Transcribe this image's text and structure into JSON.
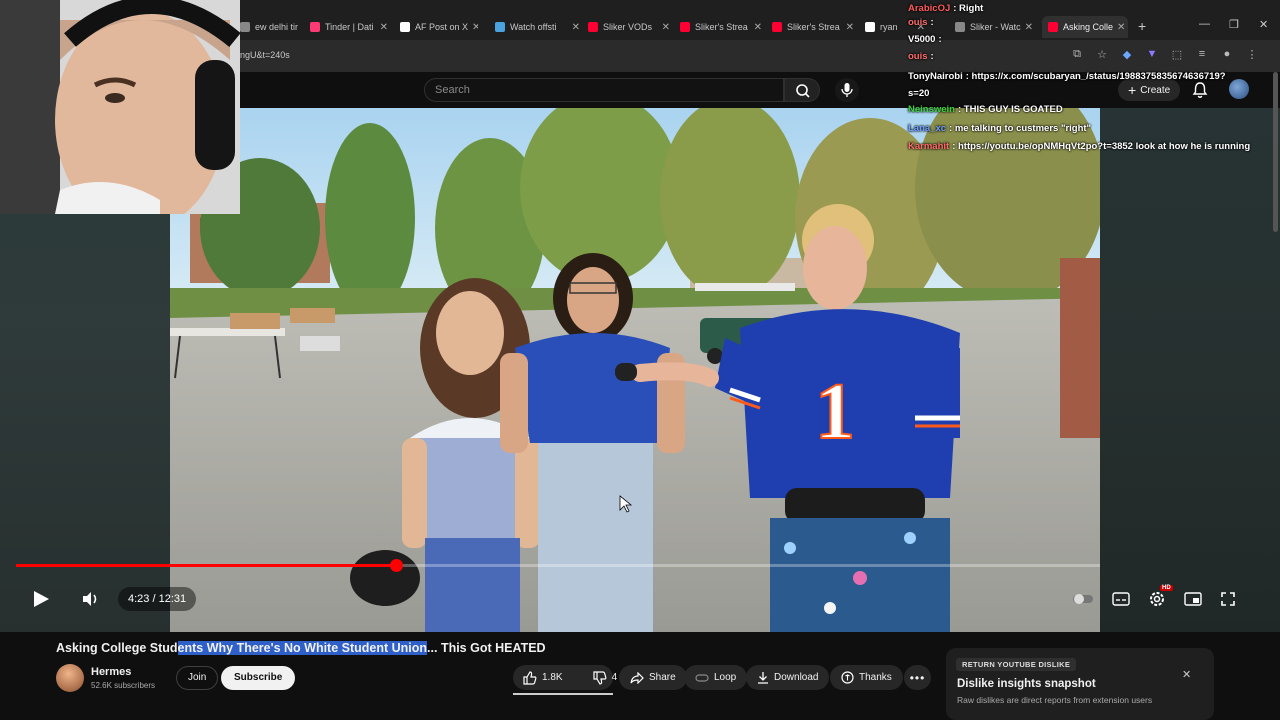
{
  "browser": {
    "tabs": [
      {
        "label": "ew delhi tir",
        "icon": "generic-tab-icon",
        "color": "#888888"
      },
      {
        "label": "Tinder | Dati",
        "icon": "tinder-icon",
        "color": "#fd3a73"
      },
      {
        "label": "AF Post on X",
        "icon": "x-icon",
        "color": "#ffffff"
      },
      {
        "label": "Watch offsti",
        "icon": "watch-icon",
        "color": "#4aa3df"
      },
      {
        "label": "Sliker VODs",
        "icon": "youtube-icon",
        "color": "#ff0033"
      },
      {
        "label": "Sliker's Strea",
        "icon": "youtube-icon",
        "color": "#ff0033"
      },
      {
        "label": "Sliker's Strea",
        "icon": "youtube-icon",
        "color": "#ff0033"
      },
      {
        "label": "ryan",
        "icon": "x-icon",
        "color": "#ffffff"
      },
      {
        "label": "Sliker - Watc",
        "icon": "generic-tab-icon",
        "color": "#888888"
      },
      {
        "label": "Asking Colle",
        "icon": "youtube-icon",
        "color": "#ff0033"
      }
    ],
    "url": "ngU&t=240s"
  },
  "header": {
    "search_placeholder": "Search",
    "create_label": "Create"
  },
  "chat": [
    {
      "user": "ArabicOJ",
      "msg": ": Right",
      "color": "#ff5a5a"
    },
    {
      "user": "ouis",
      "msg": ":",
      "color": "#ff6a6a"
    },
    {
      "user": "V5000",
      "msg": ":",
      "color": "#ffffff"
    },
    {
      "user": "ouis",
      "msg": ":",
      "color": "#ff6a6a"
    },
    {
      "user": "TonyNairobi",
      "msg": ": https://x.com/scubaryan_/status/1988375835674636719?",
      "color": "#ffffff"
    },
    {
      "user": "s=20",
      "msg": "",
      "color": "#ffffff"
    },
    {
      "user": "Neinswein",
      "msg": ": THIS GUY IS GOATED",
      "color": "#3fd13f"
    },
    {
      "user": "Lana_xc",
      "msg": ": me talking to custmers \"right\"",
      "color": "#6a9eff"
    },
    {
      "user": "Karmahit",
      "msg": ": https://youtu.be/opNMHqVt2po?t=3852 look at how he is running",
      "color": "#ff6a6a"
    }
  ],
  "player": {
    "time": "4:23 / 12:31",
    "progress": 0.351,
    "hd_badge": "HD"
  },
  "video": {
    "title_pre": "Asking College Stud",
    "title_highlight": "ents Why There's No White Student Union",
    "title_post": "... This Got HEATED",
    "jersey_number": "1"
  },
  "channel": {
    "name": "Hermes",
    "subscribers": "52.6K subscribers",
    "join_label": "Join",
    "subscribe_label": "Subscribe"
  },
  "actions": {
    "likes": "1.8K",
    "dislikes": "4",
    "share": "Share",
    "loop": "Loop",
    "download": "Download",
    "thanks": "Thanks"
  },
  "dislike_card": {
    "badge": "RETURN YOUTUBE DISLIKE",
    "title": "Dislike insights snapshot",
    "subtitle": "Raw dislikes are direct reports from extension users"
  }
}
